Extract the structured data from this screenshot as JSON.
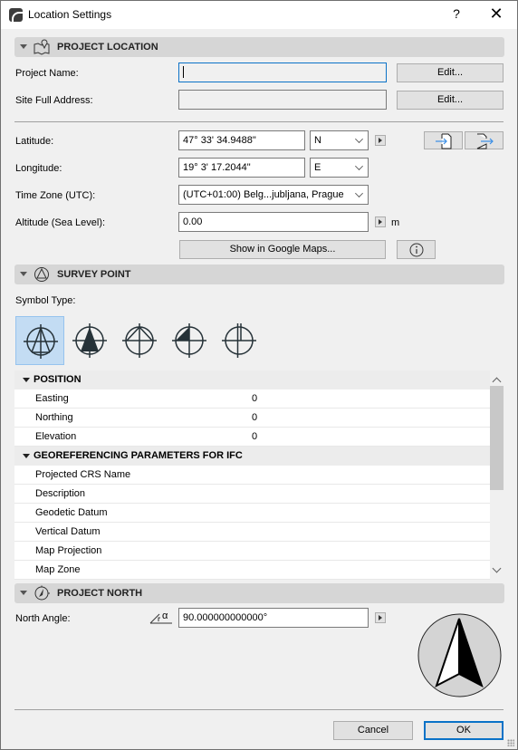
{
  "window": {
    "title": "Location Settings",
    "help_label": "?",
    "close_label": "✕"
  },
  "project_location": {
    "title": "PROJECT LOCATION",
    "icon": "map-pin-icon",
    "project_name_label": "Project Name:",
    "project_name_value": "",
    "site_address_label": "Site Full Address:",
    "site_address_value": "",
    "edit_label": "Edit...",
    "latitude_label": "Latitude:",
    "latitude_value": "47° 33' 34.9488\"",
    "latitude_dir": "N",
    "longitude_label": "Longitude:",
    "longitude_value": "19° 3' 17.2044\"",
    "longitude_dir": "E",
    "timezone_label": "Time Zone (UTC):",
    "timezone_value": "(UTC+01:00) Belg...jubljana, Prague",
    "altitude_label": "Altitude (Sea Level):",
    "altitude_value": "0.00",
    "altitude_unit": "m",
    "google_maps_label": "Show in Google Maps...",
    "import_icon": "import-file-icon",
    "export_icon": "export-file-icon",
    "info_icon": "info-icon"
  },
  "survey_point": {
    "title": "SURVEY POINT",
    "icon": "survey-point-icon",
    "symbol_type_label": "Symbol Type:",
    "selected_symbol": 0,
    "symbols": [
      "symbol-open-triangle",
      "symbol-filled-triangle",
      "symbol-chevron",
      "symbol-quarter-filled",
      "symbol-double-line"
    ]
  },
  "properties": {
    "groups": [
      {
        "title": "POSITION",
        "rows": [
          {
            "name": "Easting",
            "value": "0"
          },
          {
            "name": "Northing",
            "value": "0"
          },
          {
            "name": "Elevation",
            "value": "0"
          }
        ]
      },
      {
        "title": "GEOREFERENCING PARAMETERS FOR IFC",
        "rows": [
          {
            "name": "Projected CRS Name",
            "value": ""
          },
          {
            "name": "Description",
            "value": ""
          },
          {
            "name": "Geodetic Datum",
            "value": ""
          },
          {
            "name": "Vertical Datum",
            "value": ""
          },
          {
            "name": "Map Projection",
            "value": ""
          },
          {
            "name": "Map Zone",
            "value": ""
          }
        ]
      }
    ]
  },
  "project_north": {
    "title": "PROJECT NORTH",
    "icon": "north-arrow-icon",
    "north_angle_label": "North Angle:",
    "angle_icon_text": "α",
    "north_angle_value": "90.000000000000°"
  },
  "footer": {
    "cancel_label": "Cancel",
    "ok_label": "OK"
  },
  "colors": {
    "accent": "#0a72c7",
    "selected_bg": "#c3dcf3",
    "section_bg": "#d6d6d6"
  }
}
